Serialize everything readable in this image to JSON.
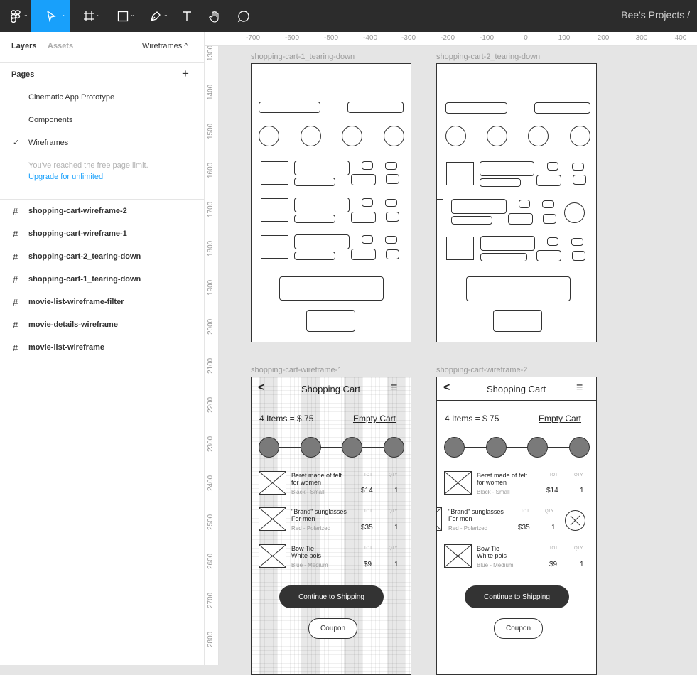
{
  "toolbar": {
    "tools": [
      "figma-menu",
      "move",
      "frame",
      "shape",
      "pen",
      "text",
      "hand",
      "comment"
    ],
    "project": "Bee's Projects /"
  },
  "panel": {
    "tabs": {
      "layers": "Layers",
      "assets": "Assets"
    },
    "current_page": "Wireframes ^",
    "pages_title": "Pages",
    "add_icon": "+",
    "pages": [
      "Cinematic App Prototype",
      "Components",
      "Wireframes"
    ],
    "selected_page": "Wireframes",
    "limit_text": "You've reached the free page limit.",
    "upgrade_text": "Upgrade for unlimited",
    "layers": [
      "shopping-cart-wireframe-2",
      "shopping-cart-wireframe-1",
      "shopping-cart-2_tearing-down",
      "shopping-cart-1_tearing-down",
      "movie-list-wireframe-filter",
      "movie-details-wireframe",
      "movie-list-wireframe"
    ]
  },
  "rulers": {
    "top": [
      "-700",
      "-600",
      "-500",
      "-400",
      "-300",
      "-200",
      "-100",
      "0",
      "100",
      "200",
      "300",
      "400"
    ],
    "left": [
      "1300",
      "1400",
      "1500",
      "1600",
      "1700",
      "1800",
      "1900",
      "2000",
      "2100",
      "2200",
      "2300",
      "2400",
      "2500",
      "2600",
      "2700",
      "2800"
    ]
  },
  "frames": {
    "f1": "shopping-cart-1_tearing-down",
    "f2": "shopping-cart-2_tearing-down",
    "f3": "shopping-cart-wireframe-1",
    "f4": "shopping-cart-wireframe-2"
  },
  "cart": {
    "back_icon": "<",
    "title": "Shopping Cart",
    "menu_icon": "≡",
    "summary": "4 Items = $ 75",
    "empty": "Empty Cart",
    "tot_label": "TOT",
    "qty_label": "QTY",
    "items": [
      {
        "name1": "Beret made of felt",
        "name2": "for women",
        "variant": "Black - Small",
        "price": "$14",
        "qty": "1"
      },
      {
        "name1": "\"Brand\" sunglasses",
        "name2": "For men",
        "variant": "Red - Polarized",
        "price": "$35",
        "qty": "1"
      },
      {
        "name1": "Bow Tie",
        "name2": "White pois",
        "variant": "Blue - Medium",
        "price": "$9",
        "qty": "1"
      }
    ],
    "continue": "Continue to Shipping",
    "coupon": "Coupon"
  }
}
